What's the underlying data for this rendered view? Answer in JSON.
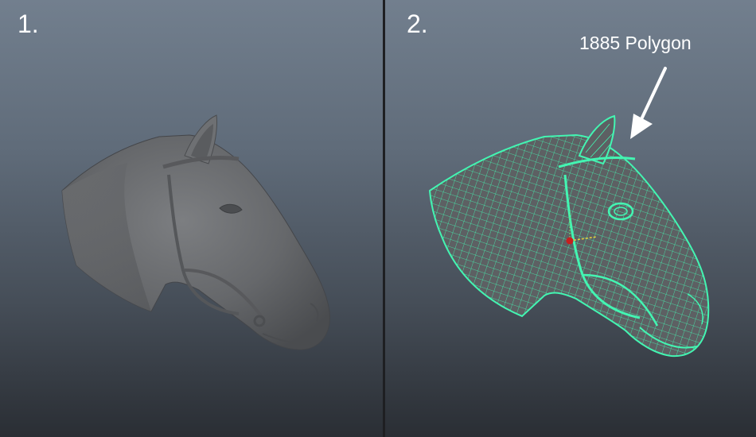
{
  "viewports": [
    {
      "label": "1.",
      "display": "smooth-shaded",
      "model": "horse-head"
    },
    {
      "label": "2.",
      "display": "wireframe-on-shaded",
      "model": "horse-head"
    }
  ],
  "annotation": {
    "text": "1885 Polygon"
  },
  "colors": {
    "wireframe": "#43f5b2",
    "shaded_gray": "#6b6d70",
    "label_text": "#ffffff",
    "divider": "#1e1f22",
    "pivot_red": "#c81e1e",
    "manipulator_yellow": "#e8d23a"
  }
}
